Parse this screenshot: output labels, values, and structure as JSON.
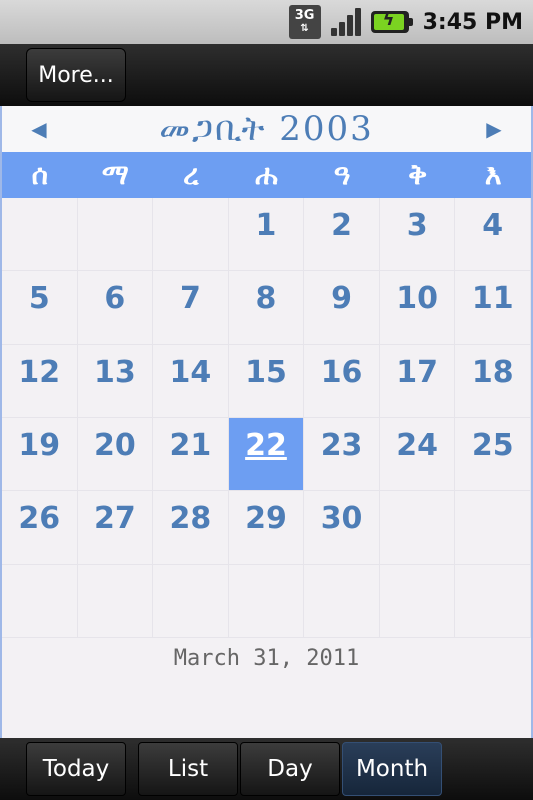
{
  "status_bar": {
    "network": "3G",
    "time": "3:45 PM",
    "icons": [
      "network-3g-icon",
      "signal-icon",
      "battery-charging-icon"
    ]
  },
  "toolbar": {
    "more_label": "More..."
  },
  "calendar": {
    "month_title": "መጋቢት 2003",
    "weekdays": [
      "ሰ",
      "ማ",
      "ረ",
      "ሐ",
      "ዓ",
      "ቅ",
      "እ"
    ],
    "weeks": [
      [
        "",
        "",
        "",
        "1",
        "2",
        "3",
        "4"
      ],
      [
        "5",
        "6",
        "7",
        "8",
        "9",
        "10",
        "11"
      ],
      [
        "12",
        "13",
        "14",
        "15",
        "16",
        "17",
        "18"
      ],
      [
        "19",
        "20",
        "21",
        "22",
        "23",
        "24",
        "25"
      ],
      [
        "26",
        "27",
        "28",
        "29",
        "30",
        "",
        ""
      ],
      [
        "",
        "",
        "",
        "",
        "",
        "",
        ""
      ]
    ],
    "selected_day": "22",
    "gregorian_date": "March 31, 2011",
    "accent_color": "#6d9ef2",
    "text_color": "#4d7db6"
  },
  "bottom_nav": {
    "today": "Today",
    "list": "List",
    "day": "Day",
    "month": "Month"
  }
}
